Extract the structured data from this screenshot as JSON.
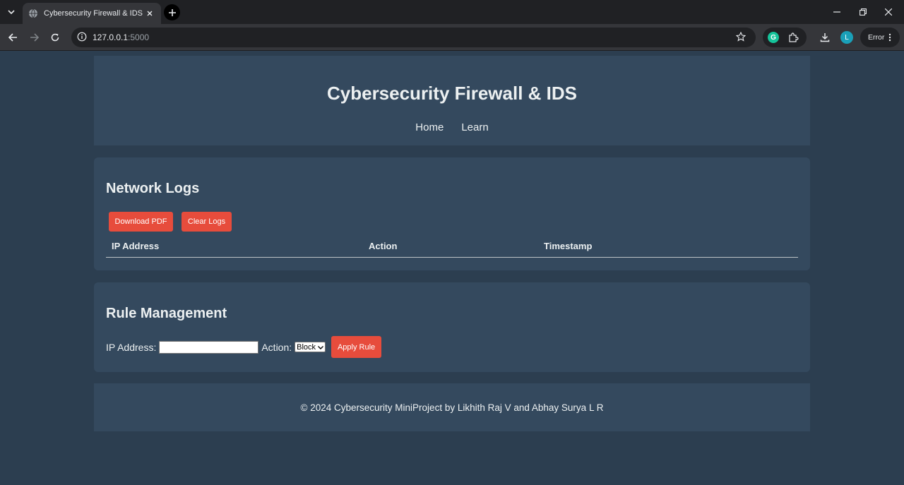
{
  "browser": {
    "tab_title": "Cybersecurity Firewall & IDS",
    "url_host": "127.0.0.1",
    "url_port": ":5000",
    "profile_initial": "L",
    "grammarly_letter": "G",
    "error_label": "Error"
  },
  "header": {
    "title": "Cybersecurity Firewall & IDS",
    "nav": [
      "Home",
      "Learn"
    ]
  },
  "logs": {
    "heading": "Network Logs",
    "download_label": "Download PDF",
    "clear_label": "Clear Logs",
    "columns": [
      "IP Address",
      "Action",
      "Timestamp"
    ]
  },
  "rules": {
    "heading": "Rule Management",
    "ip_label": "IP Address:",
    "ip_value": "",
    "action_label": "Action:",
    "action_selected": "Block",
    "apply_label": "Apply Rule"
  },
  "footer": {
    "text": "© 2024 Cybersecurity MiniProject by Likhith Raj V and Abhay Surya L R"
  },
  "colors": {
    "page_bg": "#2c3e50",
    "panel_bg": "#34495e",
    "button_red": "#e74c3c"
  }
}
